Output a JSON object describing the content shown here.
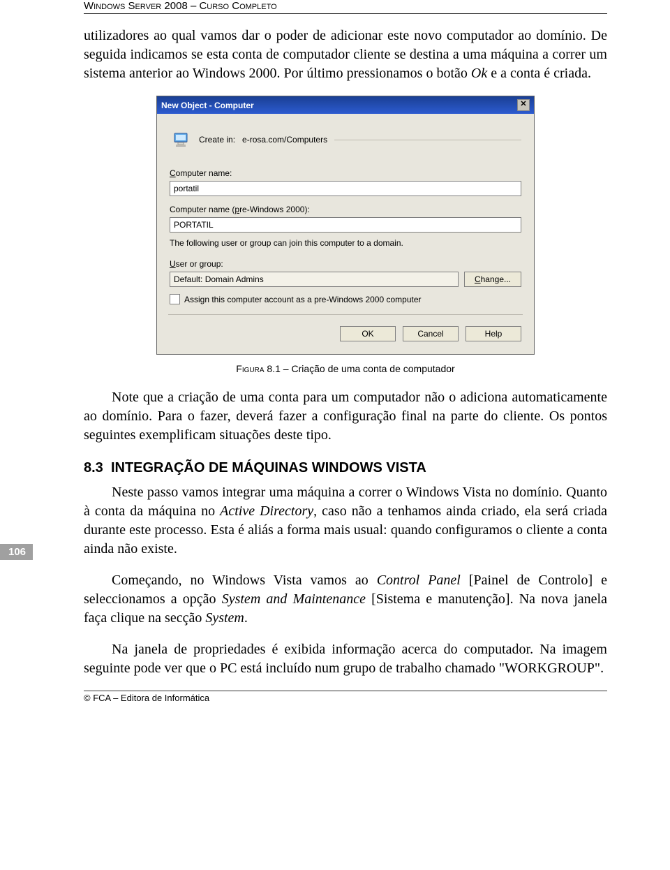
{
  "page": {
    "running_head": "Windows Server 2008 – Curso Completo",
    "page_number": "106",
    "footer": "© FCA – Editora de Informática"
  },
  "para1_a": "utilizadores ao qual vamos dar o poder de adicionar este novo computador ao domínio. De seguida indicamos se esta conta de computador cliente se destina a uma máquina a correr um sistema anterior ao Windows 2000. Por último pressionamos o botão ",
  "para1_ok": "Ok",
  "para1_b": " e a conta é criada.",
  "dialog": {
    "title": "New Object - Computer",
    "createin_label": "Create in:",
    "createin_value": "e-rosa.com/Computers",
    "computer_name_label": "Computer name:",
    "computer_name_value": "portatil",
    "prewin_label": "Computer name (pre-Windows 2000):",
    "prewin_value": "PORTATIL",
    "info": "The following user or group can join this computer to a domain.",
    "usergroup_label": "User or group:",
    "usergroup_value": "Default: Domain Admins",
    "change_btn": "Change...",
    "change_u": "C",
    "assign_label": "Assign this computer account as a pre-Windows 2000 computer",
    "ok_btn": "OK",
    "cancel_btn": "Cancel",
    "help_btn": "Help"
  },
  "caption": {
    "label": "Figura",
    "num": "8.1",
    "text": " – Criação de uma conta de computador"
  },
  "note_para": "Note que a criação de uma conta para um computador não o adiciona automaticamente ao domínio. Para o fazer, deverá fazer a configuração final na parte do cliente. Os pontos seguintes exemplificam situações deste tipo.",
  "section": {
    "num": "8.3",
    "title": "INTEGRAÇÃO DE MÁQUINAS WINDOWS VISTA"
  },
  "p3_a": "Neste passo vamos integrar uma máquina a correr o Windows Vista no domínio. Quanto à conta da máquina no ",
  "p3_ad": "Active Directory",
  "p3_b": ", caso não a tenhamos ainda criado, ela será criada durante este processo. Esta é aliás a forma mais usual: quando configuramos o cliente a conta ainda não existe.",
  "p4_a": "Começando, no Windows Vista vamos ao ",
  "p4_cp": "Control Panel",
  "p4_b": " [Painel de Controlo] e seleccionamos a opção ",
  "p4_sm": "System and Maintenance",
  "p4_c": " [Sistema e manutenção]. Na nova janela faça clique na secção ",
  "p4_sys": "System",
  "p4_d": ".",
  "p5": "Na janela de propriedades é exibida informação acerca do computador. Na imagem seguinte pode ver que o PC está incluído num grupo de trabalho chamado \"WORKGROUP\"."
}
